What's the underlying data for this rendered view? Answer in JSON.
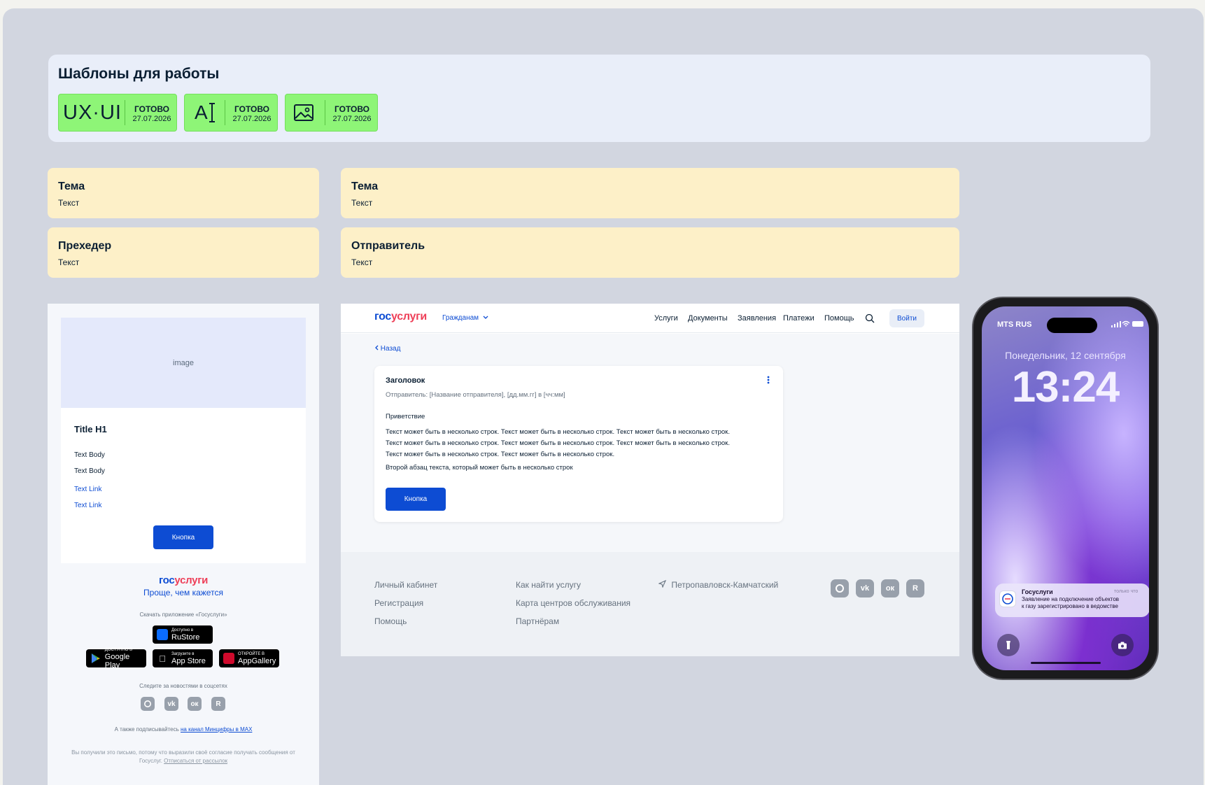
{
  "templates": {
    "title": "Шаблоны для работы",
    "badges": [
      {
        "icon": "ux-ui-icon",
        "icon_text": "UX·UI",
        "status": "ГОТОВО",
        "date": "27.07.2026"
      },
      {
        "icon": "text-cursor-icon",
        "icon_text": "A",
        "status": "ГОТОВО",
        "date": "27.07.2026"
      },
      {
        "icon": "image-icon",
        "icon_text": "",
        "status": "ГОТОВО",
        "date": "27.07.2026"
      }
    ]
  },
  "fields": [
    {
      "label": "Тема",
      "value": "Текст"
    },
    {
      "label": "Тема",
      "value": "Текст"
    },
    {
      "label": "Прехедер",
      "value": "Текст"
    },
    {
      "label": "Отправитель",
      "value": "Текст"
    }
  ],
  "email": {
    "image_placeholder": "image",
    "title": "Title H1",
    "body": [
      "Text Body",
      "Text Body"
    ],
    "links": [
      "Text Link",
      "Text Link"
    ],
    "button": "Кнопка",
    "logo_gos": "гос",
    "logo_usl": "услуги",
    "tagline": "Проще, чем кажется",
    "download_text": "Скачать приложение «Госуслуги»",
    "stores": [
      {
        "small": "Доступно в",
        "big": "RuStore"
      },
      {
        "small": "ДОСТУПНО В",
        "big": "Google Play"
      },
      {
        "small": "Загрузите в",
        "big": "App Store"
      },
      {
        "small": "ОТКРОЙТЕ В",
        "big": "AppGallery"
      }
    ],
    "social_text": "Следите за новостями в соцсетях",
    "social": [
      "max",
      "vk",
      "ok",
      "rutube"
    ],
    "subscribe_prefix": "А также подписывайтесь",
    "subscribe_link": "на канал Минцифры в MAX",
    "disclaimer": "Вы получили это письмо, потому что выразили своё согласие получать сообщения от Госуслуг.",
    "unsubscribe": "Отписаться от рассылок"
  },
  "site": {
    "logo_gos": "гос",
    "logo_usl": "услуги",
    "audience": "Гражданам",
    "nav": [
      "Услуги",
      "Документы",
      "Заявления",
      "Платежи",
      "Помощь"
    ],
    "login": "Войти",
    "back": "Назад",
    "message": {
      "title": "Заголовок",
      "sender": "Отправитель: [Название отправителя], [дд.мм.гг] в [чч:мм]",
      "greeting": "Приветствие",
      "para1_lines": [
        "Текст может быть в несколько строк. Текст может быть в несколько строк. Текст может быть в несколько строк.",
        "Текст может быть в несколько строк. Текст может быть в несколько строк. Текст может быть в несколько строк.",
        "Текст может быть в несколько строк. Текст может быть в несколько строк."
      ],
      "para2": "Второй абзац текста, который может быть в несколько строк",
      "button": "Кнопка"
    },
    "footer": {
      "col1": [
        "Личный кабинет",
        "Регистрация",
        "Помощь"
      ],
      "col2": [
        "Как найти услугу",
        "Карта центров обслуживания",
        "Партнёрам"
      ],
      "location": "Петропавловск-Камчатский",
      "social": [
        "max",
        "vk",
        "ok",
        "rutube"
      ]
    }
  },
  "phone": {
    "carrier": "MTS RUS",
    "date": "Понедельник, 12 сентября",
    "time": "13:24",
    "notification": {
      "app": "Госуслуги",
      "when": "только что",
      "line1": "Заявление на подключение объектов",
      "line2": "к газу зарегистрировано в ведомстве"
    }
  },
  "colors": {
    "brand_blue": "#0d4cd3",
    "brand_red": "#ee3f58",
    "badge_green": "#8ef577",
    "field_yellow": "#fdf0c8"
  }
}
